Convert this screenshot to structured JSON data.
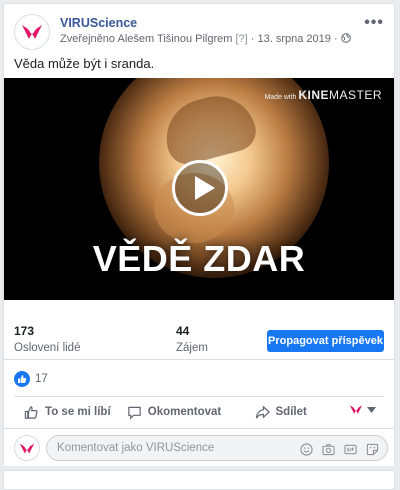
{
  "post": {
    "page_name": "VIRUScience",
    "meta_prefix": "Zveřejněno Alešem Tišinou Pilgrem",
    "meta_help": "[?]",
    "meta_sep": "·",
    "date": "13. srpna 2019",
    "text": "Věda může být i sranda."
  },
  "video": {
    "watermark_prefix": "Made with",
    "watermark_brand_bold": "KINE",
    "watermark_brand": "MASTER",
    "title_overlay": "VĚDĚ ZDAR"
  },
  "insights": {
    "reach_value": "173",
    "reach_label": "Oslovení lidé",
    "engagement_value": "44",
    "engagement_label": "Zájem",
    "promote_label": "Propagovat příspěvek"
  },
  "reactions": {
    "count": "17"
  },
  "actions": {
    "like": "To se mi líbí",
    "comment": "Okomentovat",
    "share": "Sdílet"
  },
  "comment": {
    "placeholder": "Komentovat jako VIRUScience"
  },
  "colors": {
    "accent": "#1877f2",
    "brand_pink": "#e0196a",
    "link": "#385898"
  }
}
